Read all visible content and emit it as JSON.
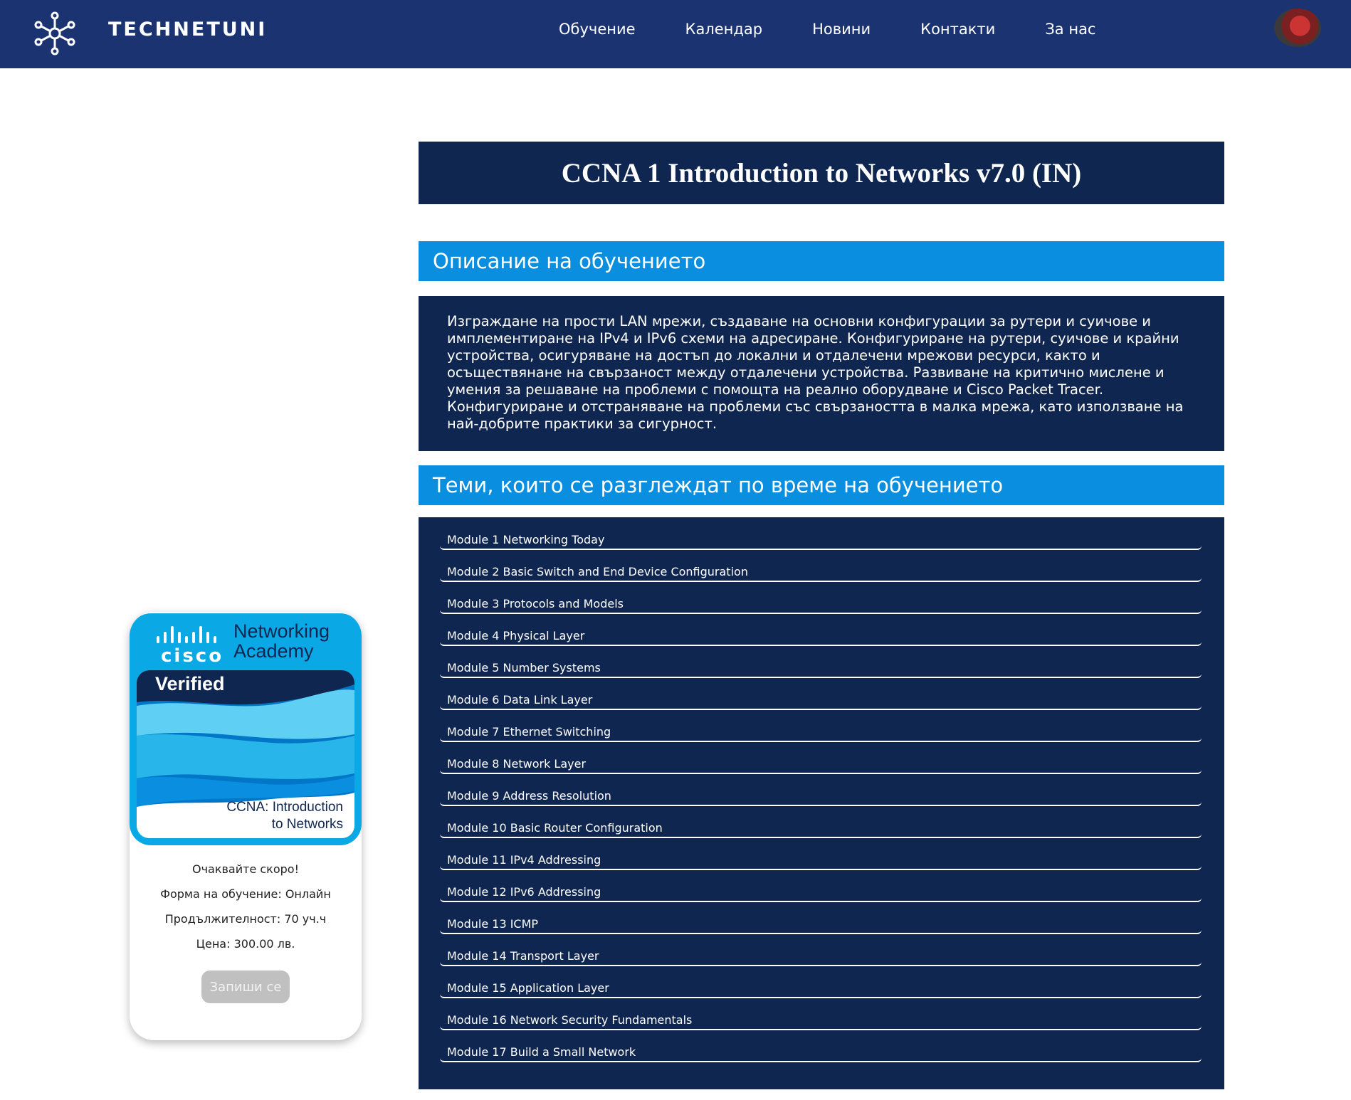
{
  "header": {
    "brand": "TECHNETUNI",
    "nav": [
      "Обучение",
      "Календар",
      "Новини",
      "Контакти",
      "За нас"
    ]
  },
  "course": {
    "title": "CCNA 1 Introduction to Networks v7.0 (IN)",
    "description_heading": "Описание на обучението",
    "description": "Изграждане на прости LAN мрежи, създаване на основни конфигурации за рутери и суичове и имплементиране на IPv4 и IPv6 схеми на адресиране. Конфигуриране на рутери, суичове и крайни устройства, осигуряване на достъп до локални и отдалечени мрежови ресурси, както и осъществянане на свързаност между отдалечени устройства. Развиване на критично мислене и умения за решаване на проблеми с помощта на реално оборудване и Cisco Packet Tracer. Конфигуриране и отстраняване на проблеми със свързаността в малка мрежа, като използване на най-добрите практики за сигурност.",
    "topics_heading": "Теми, които се разглеждат по време на обучението",
    "modules": [
      "Module 1 Networking Today",
      "Module 2 Basic Switch and End Device Configuration",
      "Module 3 Protocols and Models",
      "Module 4 Physical Layer",
      "Module 5 Number Systems",
      "Module 6 Data Link Layer",
      "Module 7 Ethernet Switching",
      "Module 8 Network Layer",
      "Module 9 Address Resolution",
      "Module 10 Basic Router Configuration",
      "Module 11 IPv4 Addressing",
      "Module 12 IPv6 Addressing",
      "Module 13 ICMP",
      "Module 14 Transport Layer",
      "Module 15 Application Layer",
      "Module 16 Network Security Fundamentals",
      "Module 17 Build a Small Network"
    ]
  },
  "card": {
    "badge": {
      "logo": "cisco",
      "academy_line1": "Networking",
      "academy_line2": "Academy",
      "verified": "Verified",
      "course_line1": "CCNA: Introduction",
      "course_line2": "to Networks"
    },
    "lines": [
      "Очаквайте скоро!",
      "Форма на обучение: Онлайн",
      "Продължителност: 70 уч.ч",
      "Цена: 300.00 лв."
    ],
    "enroll_label": "Запиши се"
  },
  "colors": {
    "header_bg": "#1b3370",
    "panel_bg": "#0f2650",
    "section_bg": "#0a8fe0",
    "button_disabled": "#c0c0c0"
  }
}
